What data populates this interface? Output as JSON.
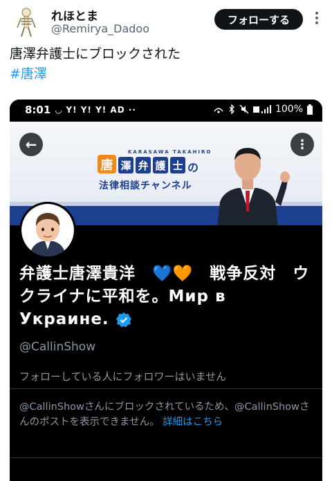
{
  "tweet": {
    "display_name": "れほとま",
    "handle": "@Remirya_Dadoo",
    "follow_label": "フォローする",
    "text": "唐澤弁護士にブロックされた",
    "hashtag": "#唐澤"
  },
  "screenshot": {
    "status_bar": {
      "time": "8:01",
      "left_icons": "◡ Y! Y! Y! AD ··",
      "battery": "100%"
    },
    "banner": {
      "romaji": "KARASAWA TAKAHIRO",
      "logo_kara": "唐",
      "logo_tiles": [
        "澤",
        "弁",
        "護",
        "士"
      ],
      "logo_no": "の",
      "logo_line2": "法律相談チャンネル"
    },
    "profile": {
      "name": "弁護士唐澤貴洋　💙🧡　戦争反対　ウクライナに平和を。Мир в Украине.",
      "handle": "@CallinShow",
      "follow_state": "フォローしている人にフォロワーはいません",
      "blocked_text": "@CallinShowさんにブロックされているため、@CallinShowさんのポストを表示できません。",
      "blocked_link": "詳細はこちら"
    },
    "colors": {
      "accent": "#1d9bf0",
      "banner_blue": "#1d3f8f",
      "logo_orange": "#f08a1c",
      "heart_blue": "#0b2fe0",
      "heart_orange": "#f5901e"
    }
  }
}
